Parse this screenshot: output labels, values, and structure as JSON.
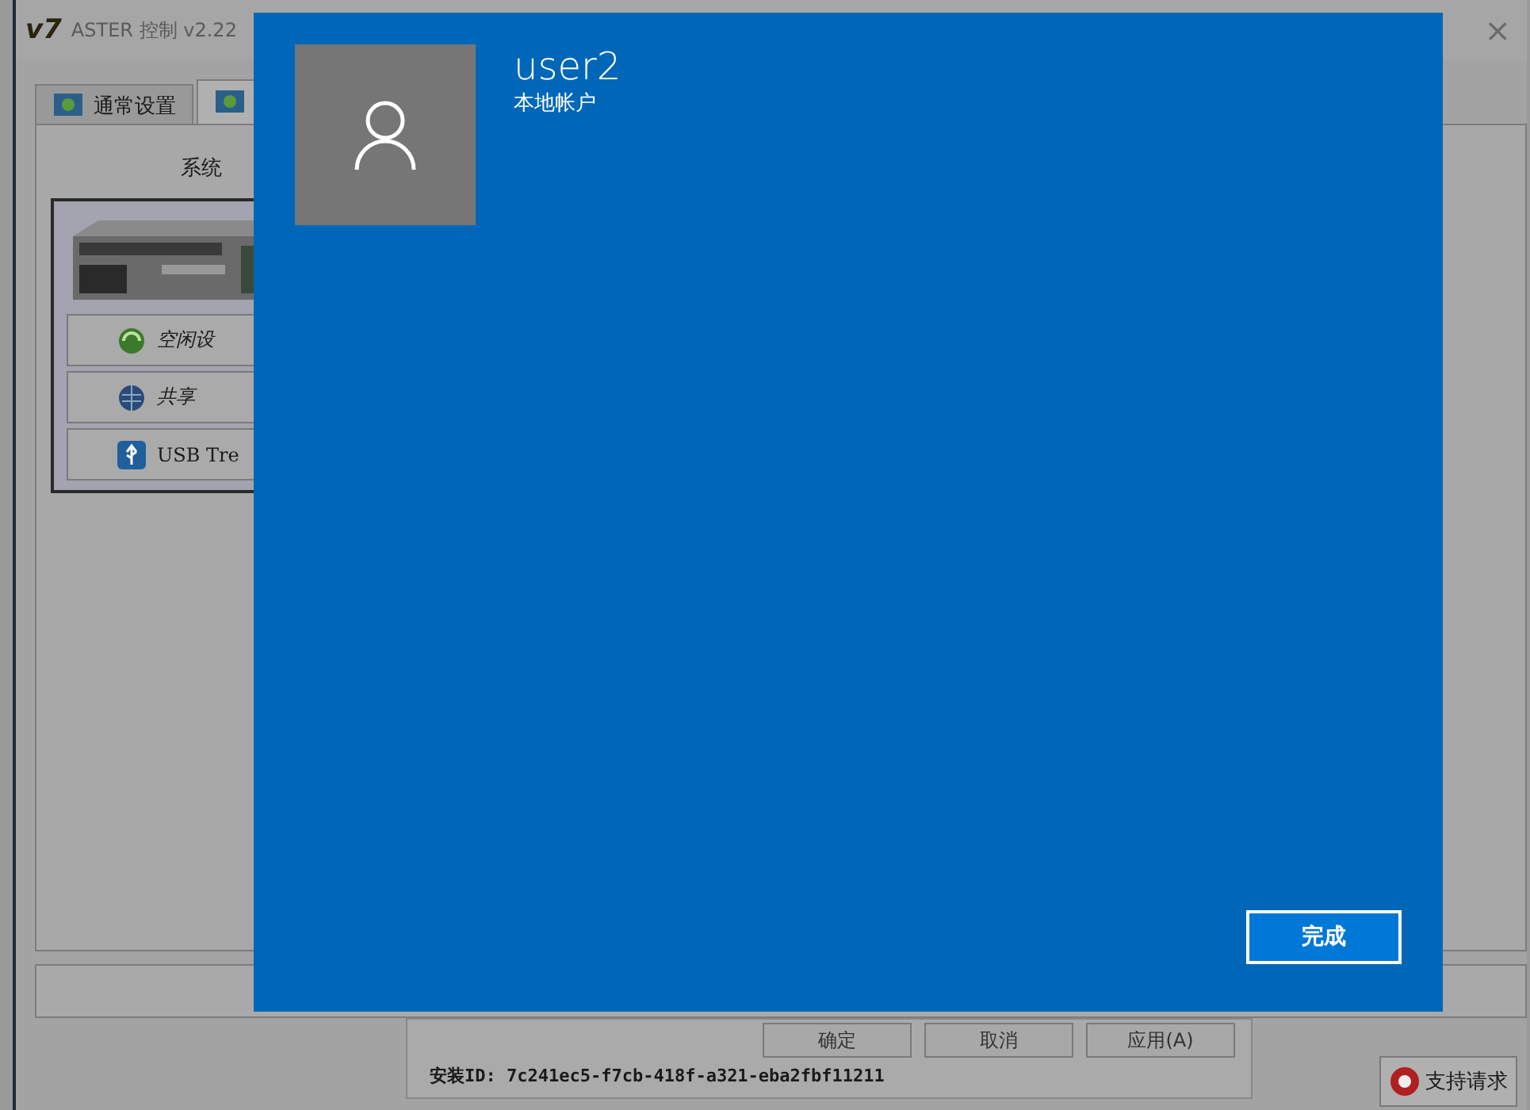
{
  "window": {
    "logo": "v7",
    "title": "ASTER 控制 v2.22",
    "close": "×"
  },
  "tabs": [
    {
      "label": "通常设置",
      "selected": false
    },
    {
      "selected": true
    }
  ],
  "system_group": {
    "title": "系统",
    "buttons": [
      {
        "label": "空闲设",
        "kind": "recycle"
      },
      {
        "label": "共享",
        "kind": "globe"
      },
      {
        "label": "USB Tre",
        "kind": "usb"
      }
    ]
  },
  "dialog": {
    "user_name": "user2",
    "account_type": "本地帐户",
    "done_button": "完成"
  },
  "footer": {
    "buttons": [
      "确定",
      "取消",
      "应用(A)"
    ],
    "install_id": "安装ID: 7c241ec5-f7cb-418f-a321-eba2fbf11211",
    "support_button": "支持请求"
  }
}
